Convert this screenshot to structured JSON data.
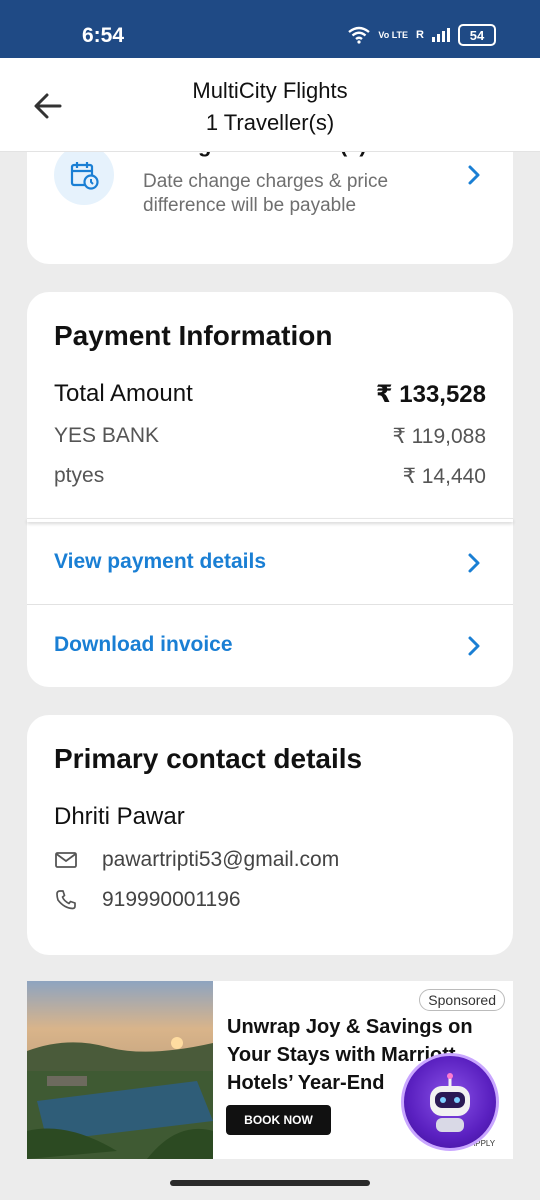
{
  "status_bar": {
    "time": "6:54",
    "network_label": "Vo LTE",
    "roaming": "R",
    "battery": "54"
  },
  "header": {
    "title": "MultiCity Flights",
    "subtitle": "1 Traveller(s)"
  },
  "date_change": {
    "title": "Change travel date(s)",
    "description": "Date change charges & price difference will be payable",
    "icon": "calendar-clock-icon"
  },
  "payment": {
    "title": "Payment Information",
    "total_label": "Total Amount",
    "total_value": "₹ 133,528",
    "lines": [
      {
        "label": "YES BANK",
        "value": "₹ 119,088"
      },
      {
        "label": "ptyes",
        "value": "₹ 14,440"
      }
    ],
    "links": [
      {
        "label": "View payment details"
      },
      {
        "label": "Download invoice"
      }
    ]
  },
  "contact": {
    "title": "Primary contact details",
    "name": "Dhriti Pawar",
    "email": "pawartripti53@gmail.com",
    "phone": "919990001196"
  },
  "ad": {
    "sponsored": "Sponsored",
    "headline": "Unwrap Joy & Savings on Your Stays with Marriott Hotels’ Year-End",
    "cta": "BOOK NOW",
    "tnc": "*T&C APPLY"
  },
  "colors": {
    "status_bar": "#1f4a85",
    "link": "#1a7fd4",
    "background": "#ececec"
  }
}
